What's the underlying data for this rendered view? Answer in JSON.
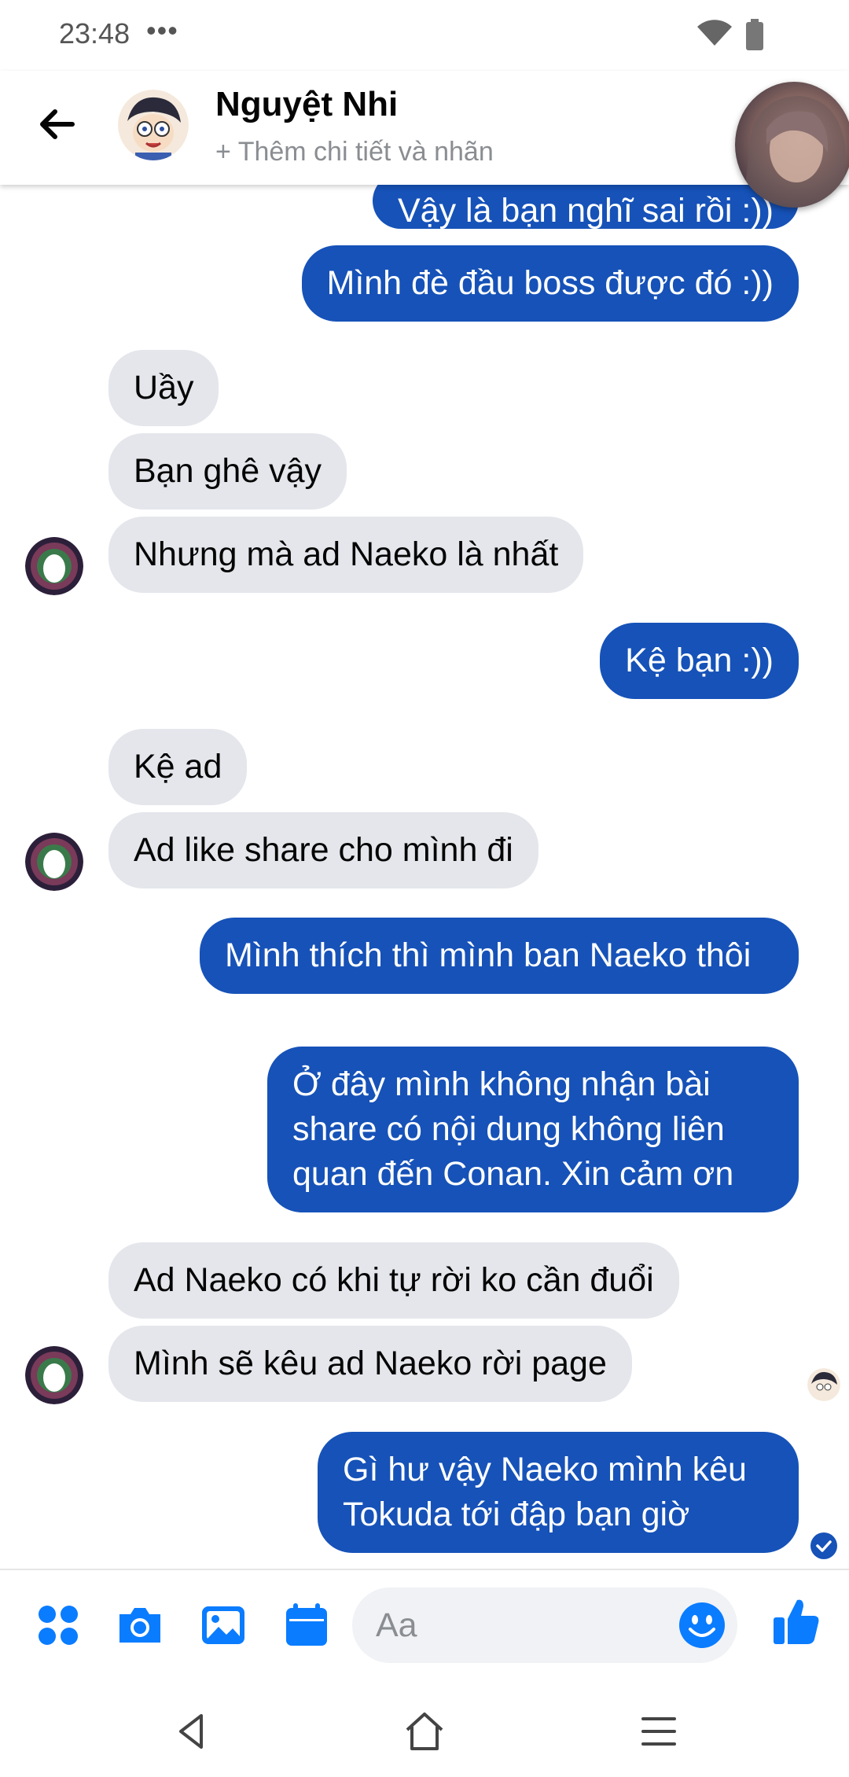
{
  "status_bar": {
    "time": "23:48",
    "dots": "•••"
  },
  "header": {
    "name": "Nguyệt Nhi",
    "subtitle": "+ Thêm chi tiết và nhãn"
  },
  "messages": [
    {
      "from": "me",
      "text": "Vậy là bạn nghĩ sai rồi :))"
    },
    {
      "from": "me",
      "text": "Mình đè đầu boss được đó :))"
    },
    {
      "from": "them",
      "text": "Uầy"
    },
    {
      "from": "them",
      "text": "Bạn ghê vậy"
    },
    {
      "from": "them",
      "text": "Nhưng mà ad Naeko là nhất"
    },
    {
      "from": "me",
      "text": "Kệ bạn :))"
    },
    {
      "from": "them",
      "text": "Kệ ad"
    },
    {
      "from": "them",
      "text": "Ad like share cho mình đi"
    },
    {
      "from": "me",
      "text": "Mình thích thì mình ban Naeko thôi"
    },
    {
      "from": "me",
      "text": "Ở đây mình không nhận bài share có nội dung không liên quan đến Conan. Xin cảm ơn"
    },
    {
      "from": "them",
      "text": "Ad Naeko có khi tự rời ko cần đuổi"
    },
    {
      "from": "them",
      "text": "Mình sẽ kêu ad Naeko rời page"
    },
    {
      "from": "me",
      "text": "Gì hư vậy Naeko mình kêu Tokuda tới đập bạn giờ"
    }
  ],
  "composer": {
    "placeholder": "Aa"
  },
  "colors": {
    "outgoing_bubble": "#1652b8",
    "incoming_bubble": "#e4e6eb",
    "accent": "#0a7cff"
  }
}
